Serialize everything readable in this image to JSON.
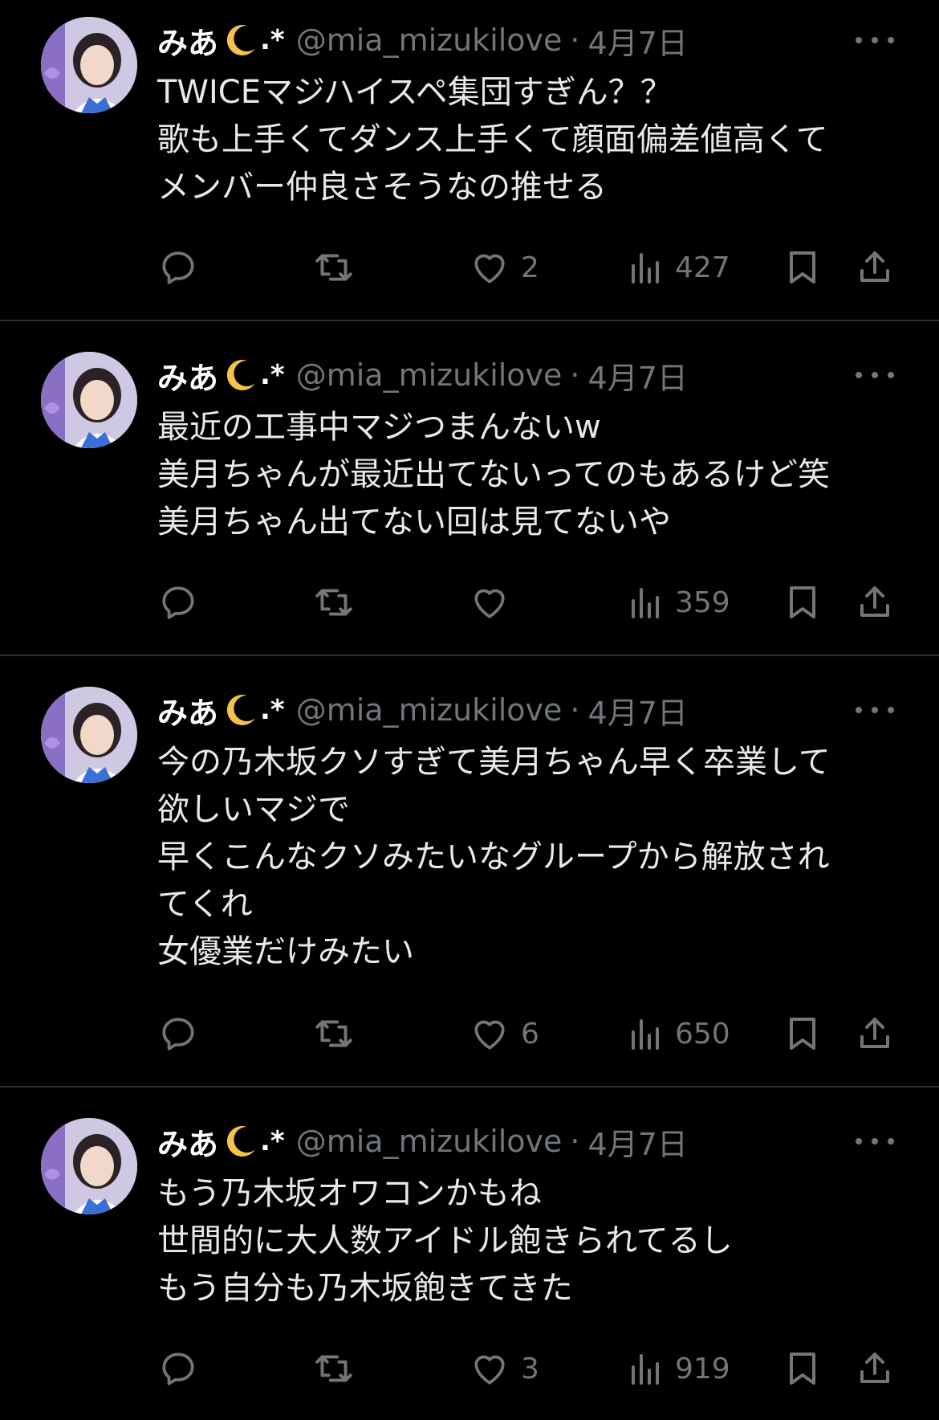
{
  "colors": {
    "background": "#000000",
    "text": "#e7e9ea",
    "muted": "#71767b",
    "divider": "#2f3336",
    "moon": "#f4c34a"
  },
  "tweets": [
    {
      "name": "みあ",
      "star": ".*",
      "handle": "@mia_mizukilove",
      "dot": "·",
      "date": "4月7日",
      "text": "TWICEマジハイスペ集団すぎん？？\n歌も上手くてダンス上手くて顔面偏差値高くて\nメンバー仲良さそうなの推せる",
      "likes": "2",
      "views": "427"
    },
    {
      "name": "みあ",
      "star": ".*",
      "handle": "@mia_mizukilove",
      "dot": "·",
      "date": "4月7日",
      "text": "最近の工事中マジつまんないw\n美月ちゃんが最近出てないってのもあるけど笑\n美月ちゃん出てない回は見てないや",
      "likes": "",
      "views": "359"
    },
    {
      "name": "みあ",
      "star": ".*",
      "handle": "@mia_mizukilove",
      "dot": "·",
      "date": "4月7日",
      "text": "今の乃木坂クソすぎて美月ちゃん早く卒業して\n欲しいマジで\n早くこんなクソみたいなグループから解放され\nてくれ\n女優業だけみたい",
      "likes": "6",
      "views": "650"
    },
    {
      "name": "みあ",
      "star": ".*",
      "handle": "@mia_mizukilove",
      "dot": "·",
      "date": "4月7日",
      "text": "もう乃木坂オワコンかもね\n世間的に大人数アイドル飽きられてるし\nもう自分も乃木坂飽きてきた",
      "likes": "3",
      "views": "919"
    }
  ],
  "icons": {
    "reply": "reply-icon",
    "retweet": "retweet-icon",
    "like": "heart-icon",
    "views": "views-icon",
    "bookmark": "bookmark-icon",
    "share": "share-icon",
    "more": "more-icon",
    "moon": "crescent-moon-icon"
  }
}
